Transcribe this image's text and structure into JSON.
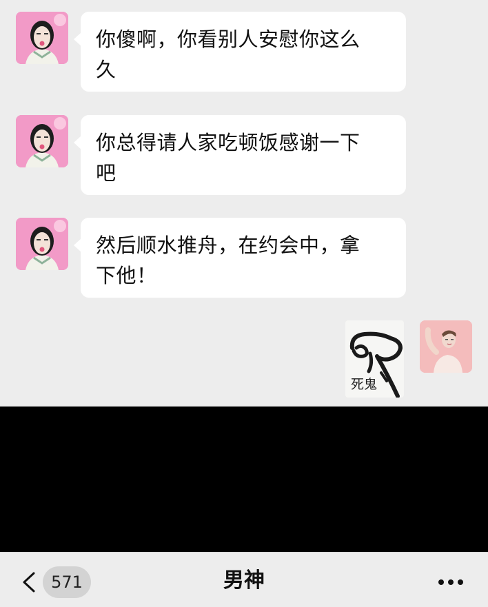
{
  "messages": [
    {
      "sender": "other",
      "text_line1": "你傻啊，你看别人安慰你这么",
      "text_line2": "久"
    },
    {
      "sender": "other",
      "text_line1": "你总得请人家吃顿饭感谢一下",
      "text_line2": "吧"
    },
    {
      "sender": "other",
      "text_line1": "然后顺水推舟，在约会中，拿",
      "text_line2": "下他！"
    },
    {
      "sender": "self",
      "type": "sticker",
      "sticker_caption": "死鬼"
    }
  ],
  "navbar": {
    "unread_count": "571",
    "title": "男神",
    "back_icon": "chevron-left-icon",
    "more_icon": "more-dots-icon"
  },
  "colors": {
    "background": "#ededed",
    "bubble": "#ffffff",
    "avatar_pink": "#f29ac7",
    "redaction": "#000000"
  }
}
